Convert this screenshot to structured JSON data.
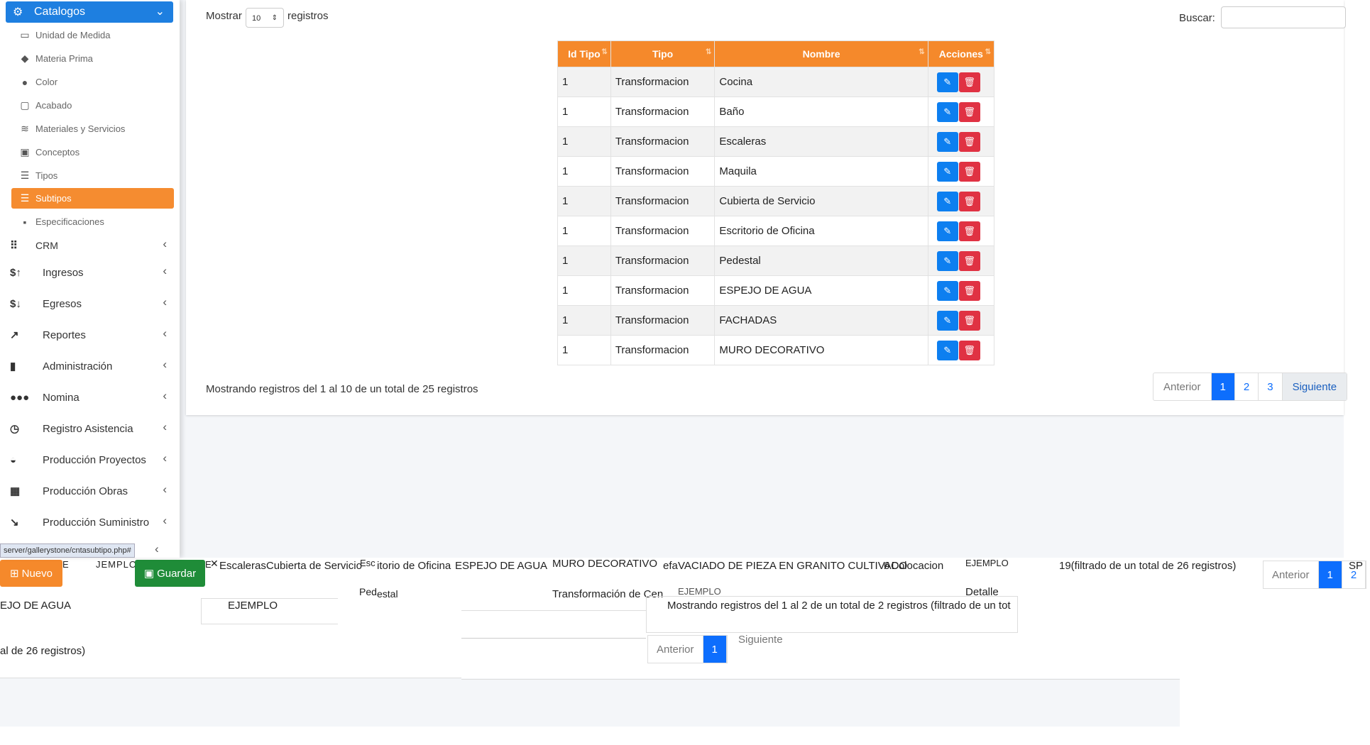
{
  "sidebar": {
    "catalog_header": "Catalogos",
    "sub_items": [
      {
        "label": "Unidad de Medida",
        "icon": "ruler-icon"
      },
      {
        "label": "Materia Prima",
        "icon": "gem-icon"
      },
      {
        "label": "Color",
        "icon": "droplet-icon"
      },
      {
        "label": "Acabado",
        "icon": "vector-square-icon"
      },
      {
        "label": "Materiales y Servicios",
        "icon": "layers-icon"
      },
      {
        "label": "Conceptos",
        "icon": "toolbox-icon"
      },
      {
        "label": "Tipos",
        "icon": "list-icon"
      },
      {
        "label": "Subtipos",
        "icon": "bars-icon"
      },
      {
        "label": "Especificaciones",
        "icon": "sticky-note-icon"
      }
    ],
    "nav_items": [
      {
        "label": "CRM",
        "icon": "grid-icon"
      },
      {
        "label": "Ingresos",
        "icon": "dollar-up-icon"
      },
      {
        "label": "Egresos",
        "icon": "dollar-down-icon"
      },
      {
        "label": "Reportes",
        "icon": "chart-line-icon"
      },
      {
        "label": "Administración",
        "icon": "book-icon"
      },
      {
        "label": "Nomina",
        "icon": "users-icon"
      },
      {
        "label": "Registro Asistencia",
        "icon": "clock-icon"
      },
      {
        "label": "Producción Proyectos",
        "icon": "hard-hat-icon"
      },
      {
        "label": "Producción Obras",
        "icon": "building-icon"
      },
      {
        "label": "Producción Suministro",
        "icon": "dolly-icon"
      }
    ],
    "status_url": "server/gallerystone/cntasubtipo.php#"
  },
  "controls": {
    "show_label": "Mostrar",
    "show_value": "10",
    "show_after": "registros",
    "search_label": "Buscar:",
    "search_value": ""
  },
  "table": {
    "columns": [
      "Id Tipo",
      "Tipo",
      "Nombre",
      "Acciones"
    ],
    "rows": [
      [
        "1",
        "Transformacion",
        "Cocina"
      ],
      [
        "1",
        "Transformacion",
        "Baño"
      ],
      [
        "1",
        "Transformacion",
        "Escaleras"
      ],
      [
        "1",
        "Transformacion",
        "Maquila"
      ],
      [
        "1",
        "Transformacion",
        "Cubierta de Servicio"
      ],
      [
        "1",
        "Transformacion",
        "Escritorio de Oficina"
      ],
      [
        "1",
        "Transformacion",
        "Pedestal"
      ],
      [
        "1",
        "Transformacion",
        "ESPEJO DE AGUA"
      ],
      [
        "1",
        "Transformacion",
        "FACHADAS"
      ],
      [
        "1",
        "Transformacion",
        "MURO DECORATIVO"
      ]
    ]
  },
  "footer": {
    "info": "Mostrando registros del 1 al 10 de un total de 25 registros",
    "prev": "Anterior",
    "pages": [
      "1",
      "2",
      "3"
    ],
    "next": "Siguiente"
  },
  "glitch": {
    "nuevo": "Nuevo",
    "guardar": "Guardar",
    "frag1": "E",
    "frag2": "JEMPLO",
    "frag3": "E",
    "frag4": "EscalerasCubierta de Servicio",
    "frag5": "Esc",
    "frag6": "itorio de Oficina",
    "frag7": "ESPEJO DE AGUA",
    "frag8": "MURO DECORATIVO",
    "frag9": "efa",
    "frag10": "VACIADO DE PIEZA EN GRANITO CULTIVADO",
    "frag11": "6",
    "frag12": "Colocacion",
    "frag13": "EJEMPLO",
    "frag14": "19(filtrado de un total de 26 registros)",
    "frag15": "Anterior",
    "frag16": "1",
    "frag17": "2",
    "frag18": "SP",
    "frag19": "Ped",
    "frag20": "estal",
    "frag21": "Transformación de Cen",
    "frag22": "EJEMPLO",
    "frag23": "Detalle",
    "frag24": "EJO DE AGUA",
    "frag25": "EJEMPLO",
    "frag26": "Mostrando registros del 1 al 2 de un total de 2 registros (filtrado de un tot",
    "frag27": "al de 26 registros)",
    "frag28": "Anterior",
    "frag29": "1",
    "frag30": "Siguiente"
  },
  "colors": {
    "primary": "#1e7fe0",
    "accent_orange": "#f5892b",
    "danger": "#e03243",
    "success": "#1f8c38"
  }
}
